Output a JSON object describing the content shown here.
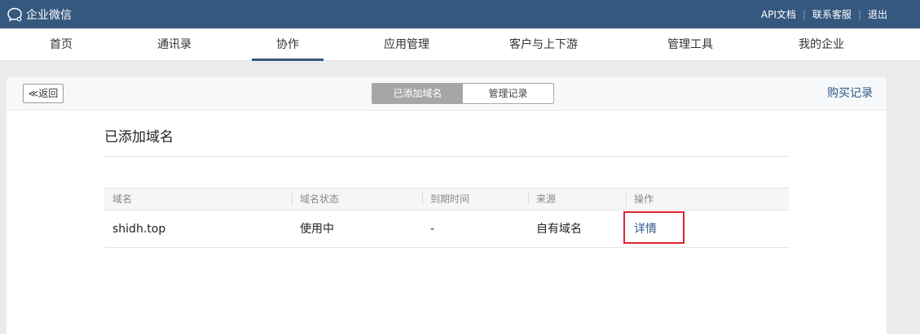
{
  "topbar": {
    "app_name": "企业微信",
    "links": [
      "API文档",
      "联系客服",
      "退出"
    ],
    "separator": "|"
  },
  "nav": {
    "items": [
      "首页",
      "通讯录",
      "协作",
      "应用管理",
      "客户与上下游",
      "管理工具",
      "我的企业"
    ],
    "active": "协作"
  },
  "panel": {
    "back_label": "≪返回",
    "segments": [
      "已添加域名",
      "管理记录"
    ],
    "active_segment": "已添加域名",
    "buy_record_label": "购买记录"
  },
  "section": {
    "title": "已添加域名"
  },
  "table": {
    "headers": [
      "域名",
      "域名状态",
      "到期时间",
      "来源",
      "操作"
    ],
    "rows": [
      {
        "domain": "shidh.top",
        "status": "使用中",
        "expiry": "-",
        "source": "自有域名",
        "action": "详情"
      }
    ]
  },
  "colors": {
    "topbar_bg": "#35587f",
    "link": "#2e5a8a",
    "highlight": "#d9272e"
  }
}
